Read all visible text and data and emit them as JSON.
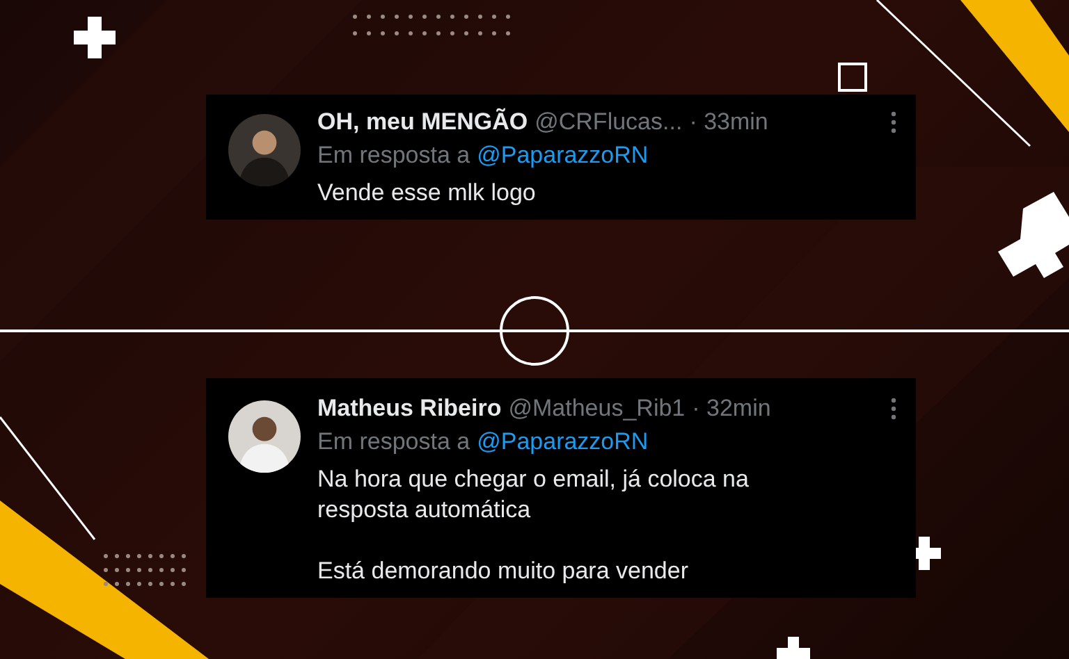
{
  "tweets": [
    {
      "name": "OH, meu MENGÃO",
      "handle": "@CRFlucas...",
      "time": "· 33min",
      "reply_prefix": "Em resposta a",
      "reply_to": "@PaparazzoRN",
      "body": [
        "Vende esse mlk logo"
      ]
    },
    {
      "name": "Matheus Ribeiro",
      "handle": "@Matheus_Rib1",
      "time": "· 32min",
      "reply_prefix": "Em resposta a",
      "reply_to": "@PaparazzoRN",
      "body": [
        "Na hora que chegar o email, já coloca na resposta automática",
        "Está demorando muito para vender"
      ]
    }
  ]
}
